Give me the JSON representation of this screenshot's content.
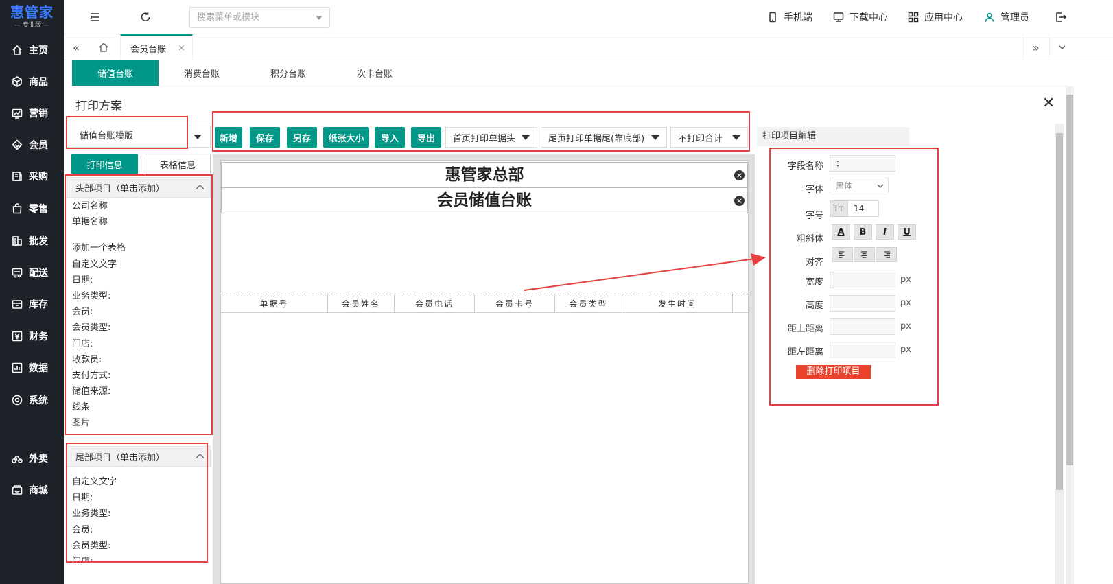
{
  "app": {
    "logo_main": "惠管家",
    "logo_sub": "— 专业版 —"
  },
  "sidebar": {
    "items": [
      {
        "label": "主页",
        "icon": "home-icon"
      },
      {
        "label": "商品",
        "icon": "cube-icon"
      },
      {
        "label": "营销",
        "icon": "chart-icon"
      },
      {
        "label": "会员",
        "icon": "diamond-icon"
      },
      {
        "label": "采购",
        "icon": "receipt-icon"
      },
      {
        "label": "零售",
        "icon": "bag-icon"
      },
      {
        "label": "批发",
        "icon": "building-icon"
      },
      {
        "label": "配送",
        "icon": "truck-icon"
      },
      {
        "label": "库存",
        "icon": "warehouse-icon"
      },
      {
        "label": "财务",
        "icon": "yen-icon"
      },
      {
        "label": "数据",
        "icon": "bars-icon"
      },
      {
        "label": "系统",
        "icon": "settings-icon"
      },
      {
        "label": "外卖",
        "icon": "bike-icon"
      },
      {
        "label": "商城",
        "icon": "shop-icon"
      }
    ]
  },
  "topbar": {
    "search_placeholder": "搜索菜单或模块",
    "mobile": "手机端",
    "download": "下载中心",
    "apps": "应用中心",
    "user": "管理员"
  },
  "tabs": {
    "current": "会员台账"
  },
  "subtabs": [
    "储值台账",
    "消费台账",
    "积分台账",
    "次卡台账"
  ],
  "print": {
    "title": "打印方案",
    "template_selected": "储值台账模版",
    "buttons": {
      "add": "新增",
      "save": "保存",
      "save_as": "另存",
      "paper": "纸张大小",
      "import": "导入",
      "export": "导出"
    },
    "dropdowns": {
      "header": "首页打印单据头",
      "footer": "尾页打印单据尾(靠底部)",
      "total": "不打印合计"
    },
    "info_tabs": {
      "print_info": "打印信息",
      "table_info": "表格信息"
    },
    "header_panel": {
      "title": "头部项目（单击添加）",
      "items": [
        "公司名称",
        "单据名称",
        "",
        "添加一个表格",
        "自定义文字",
        "日期:",
        "业务类型:",
        "会员:",
        "会员类型:",
        "门店:",
        "收款员:",
        "支付方式:",
        "储值来源:",
        "线条",
        "图片"
      ]
    },
    "footer_panel": {
      "title": "尾部项目（单击添加）",
      "items": [
        "自定义文字",
        "日期:",
        "业务类型:",
        "会员:",
        "会员类型:",
        "门店:"
      ]
    },
    "canvas": {
      "company": "惠管家总部",
      "doc_name": "会员储值台账",
      "table_columns": [
        "单据号",
        "会员姓名",
        "会员电话",
        "会员卡号",
        "会员类型",
        "发生时间"
      ]
    },
    "editor": {
      "title": "打印项目编辑",
      "field_name_label": "字段名称",
      "field_name_value": "：",
      "font_label": "字体",
      "font_value": "黑体",
      "size_label": "字号",
      "size_value": "14",
      "style_label": "粗斜体",
      "style_buttons": [
        "A",
        "B",
        "I",
        "U"
      ],
      "align_label": "对齐",
      "width_label": "宽度",
      "height_label": "高度",
      "top_label": "距上距离",
      "left_label": "距左距离",
      "unit": "px",
      "delete": "删除打印项目"
    }
  },
  "colors": {
    "sidebar_bg": "#1e2229",
    "accent": "#009688",
    "danger": "#e8412c",
    "annotation": "#e63f3f"
  }
}
